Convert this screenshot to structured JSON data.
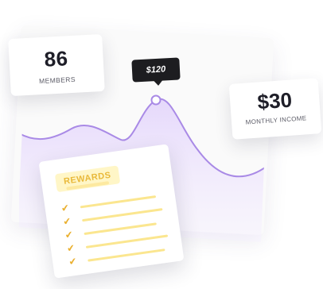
{
  "members": {
    "value": "86",
    "label": "MEMBERS"
  },
  "income": {
    "value": "$30",
    "label": "MONTHLY INCOME"
  },
  "tooltip": {
    "price": "$120"
  },
  "rewards": {
    "title": "REWARDS",
    "item_count": 5
  },
  "colors": {
    "line": "#a98ae6",
    "fill": "#e9defb",
    "tooltip_bg": "#1d1d20",
    "reward_accent": "#eab030",
    "reward_badge_bg": "#fff6c7"
  },
  "icons": [
    "check-icon"
  ]
}
